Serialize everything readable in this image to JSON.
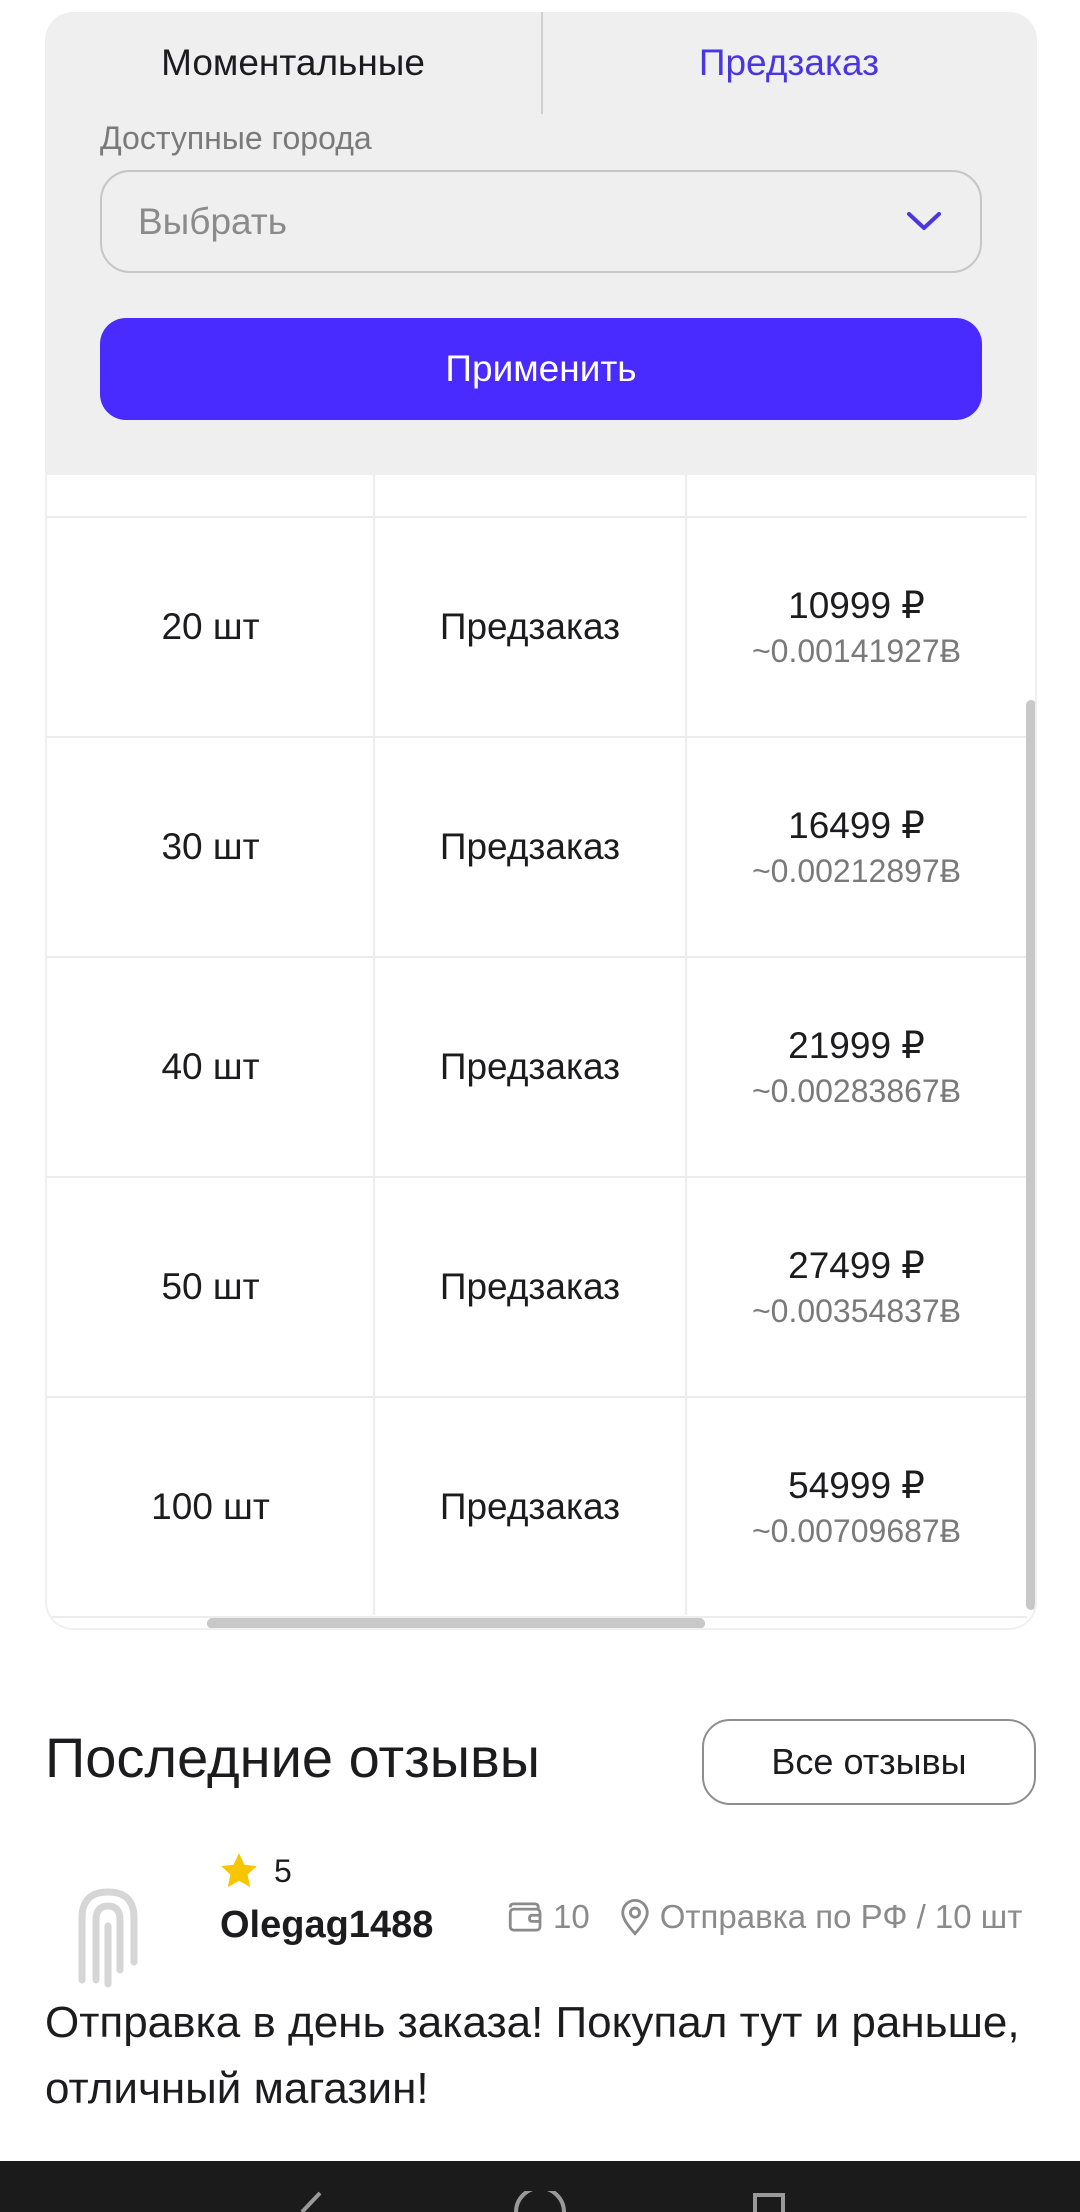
{
  "filter": {
    "tabs": [
      {
        "label": "Моментальные",
        "active": false
      },
      {
        "label": "Предзаказ",
        "active": true
      }
    ],
    "city_label": "Доступные города",
    "city_select_value": "Выбрать",
    "apply_label": "Применить",
    "colors": {
      "accent": "#4a2bff",
      "active_tab": "#4a36e0"
    }
  },
  "table": {
    "rows": [
      {
        "qty": "20 шт",
        "type": "Предзаказ",
        "price_rub": "10999 ₽",
        "price_btc": "~0.00141927Ƀ"
      },
      {
        "qty": "30 шт",
        "type": "Предзаказ",
        "price_rub": "16499 ₽",
        "price_btc": "~0.00212897Ƀ"
      },
      {
        "qty": "40 шт",
        "type": "Предзаказ",
        "price_rub": "21999 ₽",
        "price_btc": "~0.00283867Ƀ"
      },
      {
        "qty": "50 шт",
        "type": "Предзаказ",
        "price_rub": "27499 ₽",
        "price_btc": "~0.00354837Ƀ"
      },
      {
        "qty": "100 шт",
        "type": "Предзаказ",
        "price_rub": "54999 ₽",
        "price_btc": "~0.00709687Ƀ"
      }
    ]
  },
  "reviews": {
    "title": "Последние отзывы",
    "all_label": "Все отзывы",
    "items": [
      {
        "rating": "5",
        "author": "Olegag1488",
        "purchases": "10",
        "delivery": "Отправка по РФ / 10 шт",
        "text": "Отправка в день заказа! Покупал тут и раньше, отличный магазин!"
      }
    ]
  }
}
